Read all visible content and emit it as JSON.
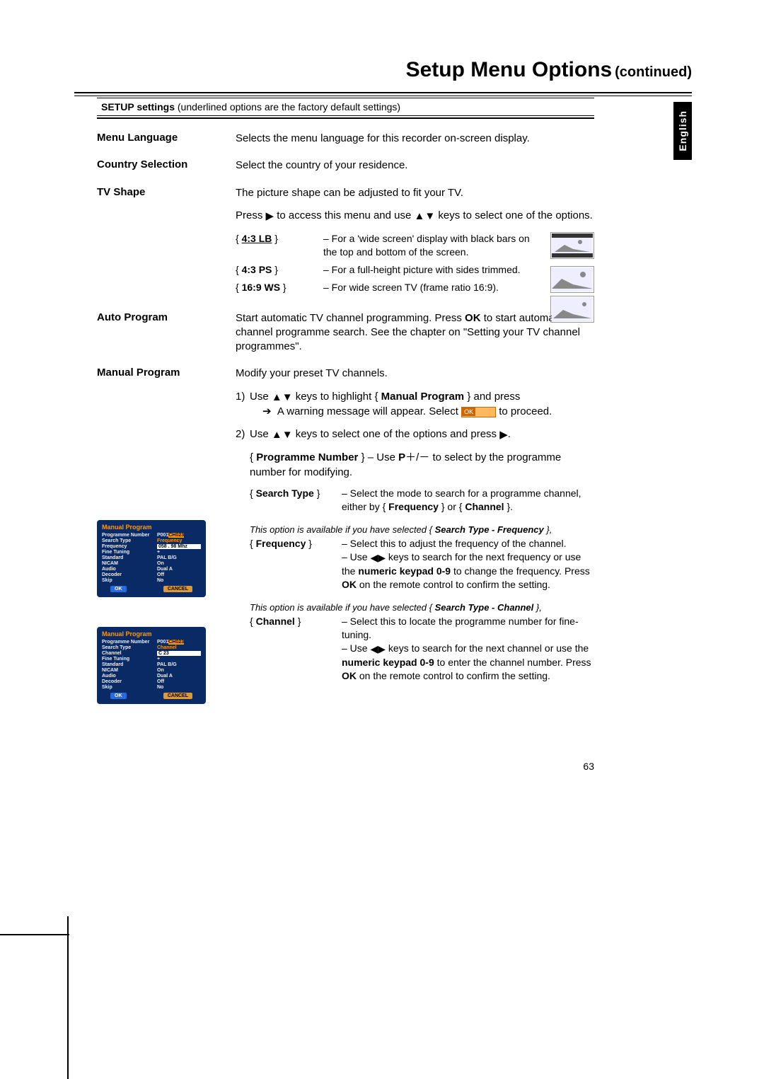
{
  "title_main": "Setup Menu Options",
  "title_cont": "(continued)",
  "lang_tab": "English",
  "setup_banner_bold": "SETUP settings",
  "setup_banner_rest": " (underlined options are the factory default settings)",
  "menu_language": {
    "label": "Menu Language",
    "desc": "Selects the menu language for this recorder on-screen display."
  },
  "country_selection": {
    "label": "Country Selection",
    "desc": "Select the country of your residence."
  },
  "tv_shape": {
    "label": "TV Shape",
    "desc1": "The picture shape can be adjusted to fit your TV.",
    "desc2a": "Press ",
    "desc2b": " to access this menu and use ",
    "desc2c": " keys to select one of the options.",
    "opt1_key": "4:3 LB",
    "opt1_desc": "– For a 'wide screen' display with black bars on the top and bottom of the screen.",
    "opt2_key": "4:3 PS",
    "opt2_desc": "– For a full-height picture with sides trimmed.",
    "opt3_key": "16:9 WS",
    "opt3_desc": "– For wide screen TV (frame ratio 16:9)."
  },
  "auto_program": {
    "label": "Auto Program",
    "desc_a": "Start automatic TV channel programming. Press ",
    "desc_ok": "OK",
    "desc_b": " to start automatic TV channel programme search. See the chapter on \"Setting your TV channel programmes\"."
  },
  "manual_program": {
    "label": "Manual Program",
    "desc": "Modify your preset TV channels.",
    "step1_a": "Use ",
    "step1_b": " keys to highlight  { ",
    "step1_bold": "Manual Program",
    "step1_c": " } and press",
    "step1_arrow_line_a": "A warning message will appear. Select ",
    "step1_arrow_line_b": " to proceed.",
    "ok_label": "OK",
    "step2_a": "Use ",
    "step2_b": " keys to select one of the options and press ",
    "step2_c": ".",
    "prog_num_key": "Programme Number",
    "prog_num_desc_a": "–  Use ",
    "prog_num_p": "P",
    "prog_num_plus": "＋",
    "prog_num_slash": "/",
    "prog_num_minus": "－",
    "prog_num_desc_b": " to select by the programme number for modifying.",
    "search_type_key": "Search Type",
    "search_type_desc_a": "– Select the mode to search for a programme channel, either by { ",
    "search_type_bold1": "Frequency",
    "search_type_mid": " } or { ",
    "search_type_bold2": "Channel",
    "search_type_end": " }.",
    "freq_ital_a": "This option is available if you have selected { ",
    "freq_ital_bold": "Search Type - Frequency",
    "freq_ital_b": " },",
    "freq_key": "Frequency",
    "freq_desc_a": "– Select this to adjust the frequency of the channel.",
    "freq_desc_b1": "– Use ",
    "freq_desc_b2": " keys to search for the next frequency or use the ",
    "freq_desc_bold": "numeric keypad 0-9",
    "freq_desc_b3": " to change the frequency. Press ",
    "freq_desc_ok": "OK",
    "freq_desc_b4": " on the remote control to confirm the setting.",
    "chan_ital_a": "This option is available if you have selected { ",
    "chan_ital_bold": "Search Type - Channel",
    "chan_ital_b": " },",
    "chan_key": "Channel",
    "chan_desc_a": "– Select this to locate the programme number for fine-tuning.",
    "chan_desc_b1": "– Use ",
    "chan_desc_b2": " keys to search for the next channel or use the ",
    "chan_desc_bold": "numeric keypad 0-9",
    "chan_desc_b3": " to enter the channel number. Press ",
    "chan_desc_ok": "OK",
    "chan_desc_b4": " on the remote control to confirm the setting."
  },
  "osd1": {
    "title": "Manual Program",
    "rows": [
      {
        "k": "Programme Number",
        "v1": "P001",
        "v2": "CH023"
      },
      {
        "k": "Search Type",
        "v": "Frequency",
        "or": true
      },
      {
        "k": "Frequency",
        "v": "058 . 98 Mhz",
        "hl": true
      },
      {
        "k": "Fine Tuning",
        "v": "+"
      },
      {
        "k": "Standard",
        "v": "PAL B/G"
      },
      {
        "k": "NICAM",
        "v": "On"
      },
      {
        "k": "Audio",
        "v": "Dual A"
      },
      {
        "k": "Decoder",
        "v": "Off"
      },
      {
        "k": "Skip",
        "v": "No"
      }
    ],
    "ok": "OK",
    "cancel": "CANCEL"
  },
  "osd2": {
    "title": "Manual Program",
    "rows": [
      {
        "k": "Programme Number",
        "v1": "P001",
        "v2": "CH023"
      },
      {
        "k": "Search Type",
        "v": "Channel",
        "or": true
      },
      {
        "k": "Channel",
        "v": "C 23",
        "hl": true
      },
      {
        "k": "Fine Tuning",
        "v": "+"
      },
      {
        "k": "Standard",
        "v": "PAL B/G"
      },
      {
        "k": "NICAM",
        "v": "On"
      },
      {
        "k": "Audio",
        "v": "Dual A"
      },
      {
        "k": "Decoder",
        "v": "Off"
      },
      {
        "k": "Skip",
        "v": "No"
      }
    ],
    "ok": "OK",
    "cancel": "CANCEL"
  },
  "page_num": "63"
}
